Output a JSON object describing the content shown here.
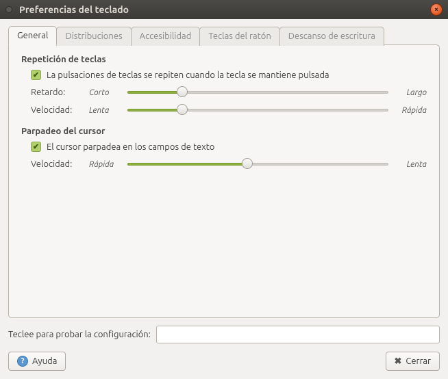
{
  "window": {
    "title": "Preferencias del teclado"
  },
  "tabs": [
    {
      "label": "General",
      "active": true
    },
    {
      "label": "Distribuciones",
      "active": false
    },
    {
      "label": "Accesibilidad",
      "active": false
    },
    {
      "label": "Teclas del ratón",
      "active": false
    },
    {
      "label": "Descanso de escritura",
      "active": false
    }
  ],
  "repeat": {
    "title": "Repetición de teclas",
    "checkbox_label": "La pulsaciones de teclas se repiten cuando la tecla se mantiene pulsada",
    "checked": true,
    "delay": {
      "label": "Retardo:",
      "min_text": "Corto",
      "max_text": "Largo",
      "percent": 21
    },
    "speed": {
      "label": "Velocidad:",
      "min_text": "Lenta",
      "max_text": "Rápida",
      "percent": 21
    }
  },
  "cursor": {
    "title": "Parpadeo del cursor",
    "checkbox_label": "El cursor parpadea en los campos de texto",
    "checked": true,
    "speed": {
      "label": "Velocidad:",
      "min_text": "Rápida",
      "max_text": "Lenta",
      "percent": 46
    }
  },
  "test": {
    "label": "Teclee para probar la configuración:",
    "value": ""
  },
  "buttons": {
    "help": "Ayuda",
    "close": "Cerrar"
  }
}
